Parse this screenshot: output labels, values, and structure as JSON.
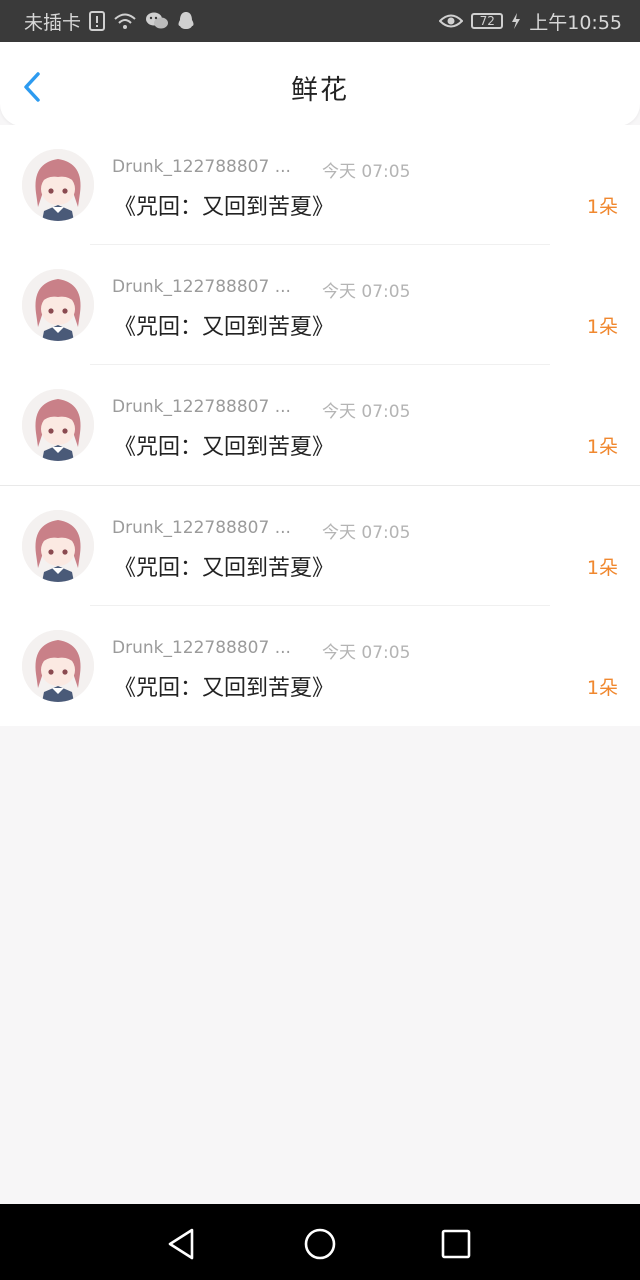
{
  "status_bar": {
    "carrier": "未插卡",
    "battery": "72",
    "time": "上午10:55",
    "icons": [
      "sim-alert-icon",
      "wifi-icon",
      "wechat-icon",
      "qq-icon",
      "eye-icon",
      "battery-icon",
      "charging-icon"
    ]
  },
  "header": {
    "title": "鲜花",
    "back_icon": "chevron-left-icon",
    "accent_color": "#2d9bf0"
  },
  "items": [
    {
      "username": "Drunk_122788807 ...",
      "time": "今天 07:05",
      "title": "《咒回：又回到苦夏》",
      "count": "1朵"
    },
    {
      "username": "Drunk_122788807 ...",
      "time": "今天 07:05",
      "title": "《咒回：又回到苦夏》",
      "count": "1朵"
    },
    {
      "username": "Drunk_122788807 ...",
      "time": "今天 07:05",
      "title": "《咒回：又回到苦夏》",
      "count": "1朵"
    },
    {
      "username": "Drunk_122788807 ...",
      "time": "今天 07:05",
      "title": "《咒回：又回到苦夏》",
      "count": "1朵"
    },
    {
      "username": "Drunk_122788807 ...",
      "time": "今天 07:05",
      "title": "《咒回：又回到苦夏》",
      "count": "1朵"
    }
  ],
  "colors": {
    "count": "#f0882f",
    "background": "#f7f6f7"
  },
  "nav_bar": {
    "icons": [
      "back-triangle-icon",
      "home-circle-icon",
      "recents-square-icon"
    ]
  }
}
